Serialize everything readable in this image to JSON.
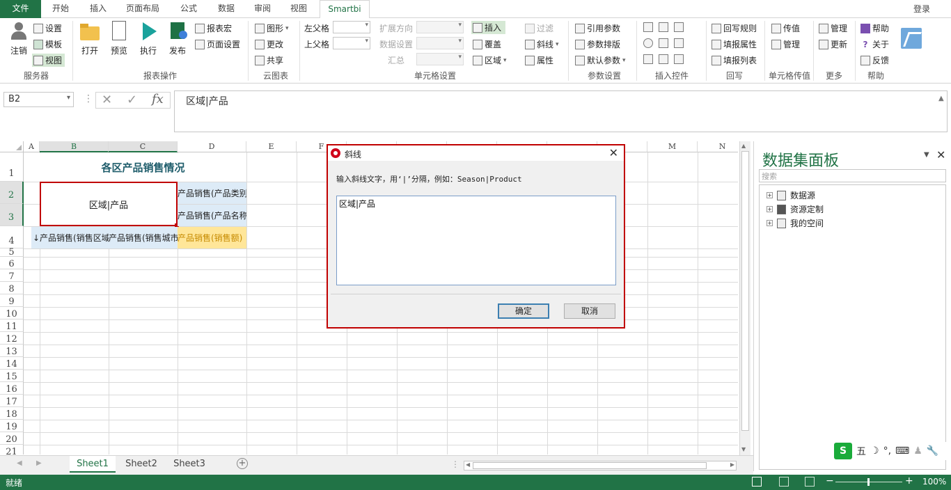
{
  "tabs": {
    "file": "文件",
    "items": [
      "开始",
      "插入",
      "页面布局",
      "公式",
      "数据",
      "审阅",
      "视图",
      "Smartbi"
    ],
    "login": "登录"
  },
  "ribbon": {
    "server": {
      "logout": "注销",
      "settings": "设置",
      "template": "模板",
      "view": "视图",
      "group": "服务器"
    },
    "report": {
      "open": "打开",
      "preview": "预览",
      "execute": "执行",
      "publish": "发布",
      "macro": "报表宏",
      "page_setup": "页面设置",
      "group": "报表操作"
    },
    "cloud": {
      "chart": "图形",
      "change": "更改",
      "share": "共享",
      "group": "云图表"
    },
    "cell": {
      "left_parent": "左父格",
      "top_parent": "上父格",
      "expand_dir": "扩展方向",
      "data_settings": "数据设置",
      "summary": "汇总",
      "insert": "插入",
      "cover": "覆盖",
      "area": "区域",
      "filter": "过滤",
      "diagonal": "斜线",
      "property": "属性",
      "group": "单元格设置"
    },
    "param": {
      "ref_param": "引用参数",
      "param_layout": "参数排版",
      "default_param": "默认参数",
      "group": "参数设置"
    },
    "controls": {
      "group": "插入控件"
    },
    "writeback": {
      "rules": "回写规则",
      "fill_props": "填报属性",
      "fill_list": "填报列表",
      "group": "回写"
    },
    "pass": {
      "pass_value": "传值",
      "manage": "管理",
      "group": "单元格传值"
    },
    "more": {
      "manage": "管理",
      "update": "更新",
      "group": "更多"
    },
    "help": {
      "help": "帮助",
      "about": "关于",
      "feedback": "反馈",
      "group": "帮助"
    }
  },
  "formula_bar": {
    "name_box": "B2",
    "content": "区域|产品"
  },
  "sheet": {
    "columns": [
      "A",
      "B",
      "C",
      "D",
      "E",
      "F",
      "M",
      "N"
    ],
    "rows": [
      "1",
      "2",
      "3",
      "4",
      "5",
      "6",
      "7",
      "8",
      "9",
      "10",
      "11",
      "12",
      "13",
      "14",
      "15",
      "16",
      "17",
      "18",
      "19",
      "20",
      "21"
    ],
    "title": "各区产品销售情况",
    "b2": "区域|产品",
    "d2": "产品销售(产品类别)",
    "d3": "产品销售(产品名称)",
    "b4": "↓产品销售(销售区域)",
    "c4": "产品销售(销售城市)",
    "d4": "产品销售(销售额)"
  },
  "dialog": {
    "title": "斜线",
    "message": "输入斜线文字，用‘|’分隔，例如：Season|Product",
    "text_value": "区域|产品",
    "ok": "确定",
    "cancel": "取消"
  },
  "panel": {
    "title": "数据集面板",
    "search_placeholder": "搜索",
    "tree": [
      "数据源",
      "资源定制",
      "我的空间"
    ]
  },
  "ime": {
    "logo": "S",
    "mode": "五"
  },
  "sheet_tabs": [
    "Sheet1",
    "Sheet2",
    "Sheet3"
  ],
  "status": {
    "ready": "就绪",
    "zoom": "100%"
  },
  "colors": {
    "accent": "#217346",
    "dialog_border": "#c00000",
    "title_text": "#1f5d6b",
    "header_blue": "#ddebf7",
    "header_yellow": "#ffe699"
  }
}
